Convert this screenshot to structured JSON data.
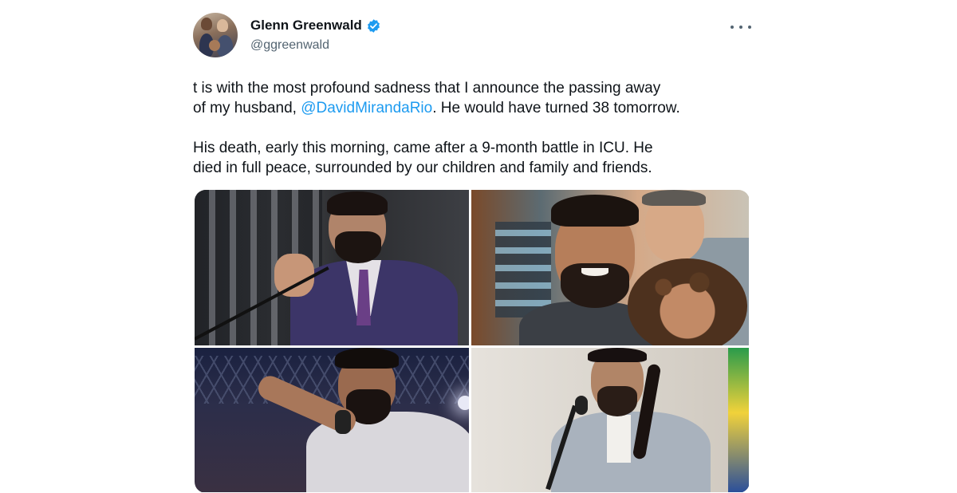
{
  "author": {
    "display_name": "Glenn Greenwald",
    "handle": "@ggreenwald",
    "verified": true,
    "verified_color": "#1d9bf0"
  },
  "tweet": {
    "line1": "t is with the most profound sadness that I announce the passing away",
    "line2_prefix": "of my husband, ",
    "mention": "@DavidMirandaRio",
    "line2_suffix": ". He would have turned 38 tomorrow.",
    "line3": "His death, early this morning, came after a 9-month battle in ICU. He",
    "line4": "died in full peace, surrounded by our children and family and friends."
  },
  "media": {
    "count": 4,
    "photos": [
      "speech-at-podium",
      "family-selfie",
      "stage-speech",
      "committee-hearing"
    ]
  },
  "icons": {
    "verified": "verified-badge-icon",
    "more": "more-options-icon"
  },
  "colors": {
    "text": "#0f1419",
    "secondary": "#536471",
    "link": "#1d9bf0"
  }
}
